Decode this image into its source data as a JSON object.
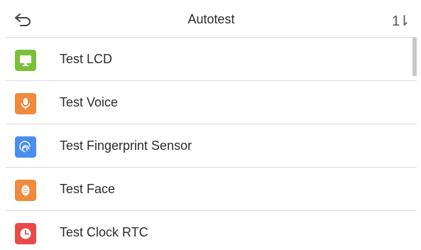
{
  "header": {
    "title": "Autotest",
    "back_icon": "back-arrow-icon",
    "sort_icon": "sort-icon",
    "sort_glyph": "1⇂"
  },
  "items": [
    {
      "label": "Test LCD",
      "icon": "monitor-icon",
      "color": "#7bbf3a"
    },
    {
      "label": "Test Voice",
      "icon": "microphone-icon",
      "color": "#f08a3c"
    },
    {
      "label": "Test Fingerprint Sensor",
      "icon": "fingerprint-icon",
      "color": "#4a8ef0"
    },
    {
      "label": "Test Face",
      "icon": "face-icon",
      "color": "#f08a3c"
    },
    {
      "label": "Test Clock RTC",
      "icon": "clock-icon",
      "color": "#e84a4a"
    }
  ]
}
